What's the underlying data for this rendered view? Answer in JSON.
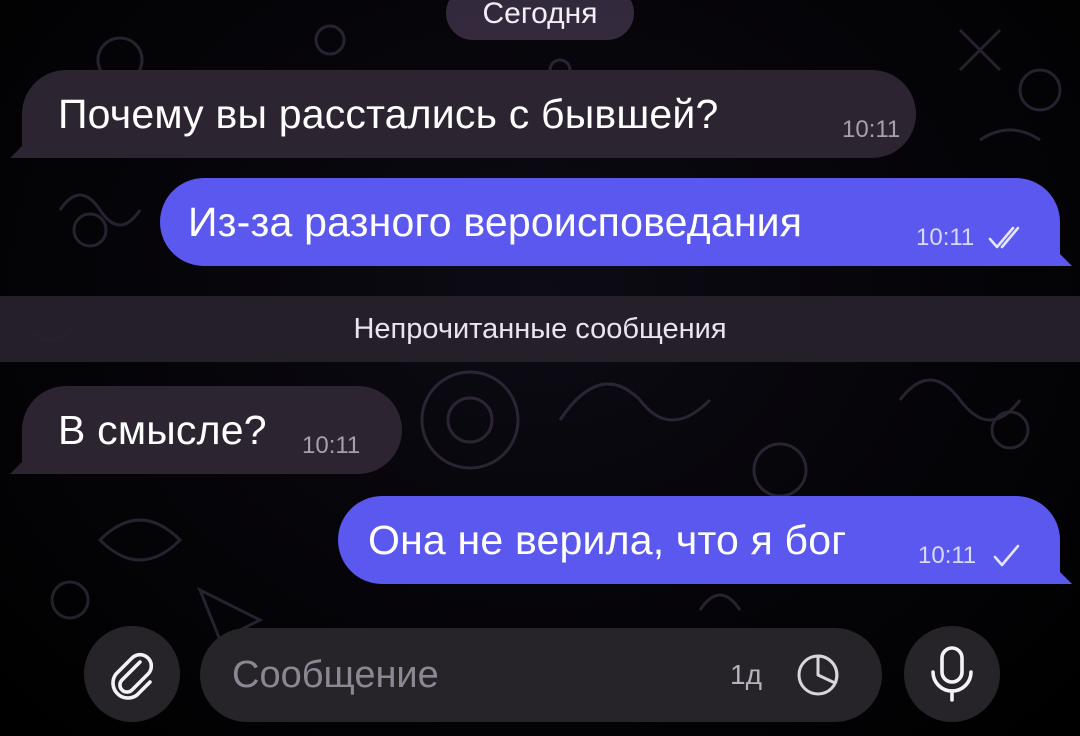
{
  "date_label": "Сегодня",
  "messages": [
    {
      "direction": "incoming",
      "text": "Почему вы расстались с бывшей?",
      "time": "10:11"
    },
    {
      "direction": "outgoing",
      "text": "Из-за разного вероисповедания",
      "time": "10:11",
      "status": "read-double-check"
    },
    {
      "direction": "incoming",
      "text": "В смысле?",
      "time": "10:11"
    },
    {
      "direction": "outgoing",
      "text": "Она не верила, что я бог",
      "time": "10:11",
      "status": "sent-single-check"
    }
  ],
  "unread_divider": "Непрочитанные сообщения",
  "composer": {
    "attach_icon": "paperclip-icon",
    "placeholder": "Сообщение",
    "timer_label": "1д",
    "timer_icon": "self-destruct-timer-icon",
    "mic_icon": "microphone-icon"
  },
  "colors": {
    "outgoing_bubble": "#5b58f0",
    "incoming_bubble": "#2c2430",
    "background": "#000000"
  }
}
